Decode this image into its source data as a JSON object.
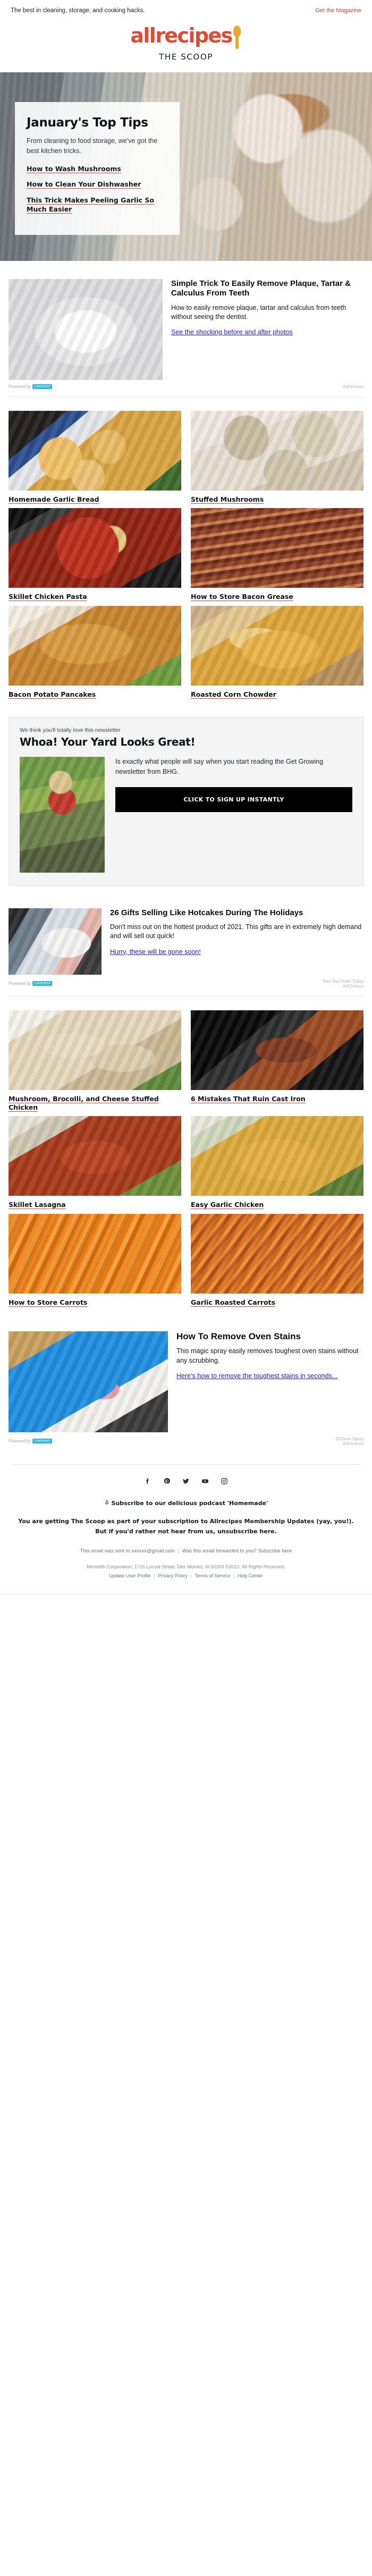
{
  "preheader": {
    "text": "The best in cleaning, storage, and cooking hacks.",
    "magazine_link": "Get the Magazine"
  },
  "brand": {
    "logo_word": "allrecipes",
    "tagline": "THE SCOOP"
  },
  "hero": {
    "title": "January's Top Tips",
    "subtitle": "From cleaning to food storage, we've got the best kitchen tricks.",
    "links": [
      "How to Wash Mushrooms",
      "How to Clean Your Dishwasher",
      "This Trick Makes Peeling Garlic So Much Easier"
    ]
  },
  "ads": [
    {
      "title": "Simple Trick To Easily Remove Plaque, Tartar & Calculus From Teeth",
      "description": "How to easily remove plaque, tartar and calculus from teeth without seeing the dentist.",
      "cta": "See the shocking before and after photos",
      "powered_label": "Powered by",
      "powered_badge": "LiveIntent",
      "sponsor": "",
      "adchoices": "AdChoices"
    },
    {
      "title": "26 Gifts Selling Like Hotcakes During The Holidays",
      "description": "Don't miss out on the hottest product of 2021. This gifts are in extremely high demand and will sell out quick!",
      "cta": "Hurry, these will be gone soon!",
      "powered_label": "Powered by",
      "powered_badge": "LiveIntent",
      "sponsor": "Your Top Deals Today",
      "adchoices": "AdChoices"
    },
    {
      "title": "How To Remove Oven Stains",
      "description": "This magic spray easily removes toughest oven stains without any scrubbing.",
      "cta": "Here's how to remove the toughest stains in seconds...",
      "powered_label": "Powered by",
      "powered_badge": "LiveIntent",
      "sponsor": "DrClean Spray",
      "adchoices": "AdChoices"
    }
  ],
  "recipes_top": [
    {
      "title": "Homemade Garlic Bread"
    },
    {
      "title": "Stuffed Mushrooms"
    },
    {
      "title": "Skillet Chicken Pasta"
    },
    {
      "title": "How to Store Bacon Grease"
    },
    {
      "title": "Bacon Potato Pancakes"
    },
    {
      "title": "Roasted Corn Chowder"
    }
  ],
  "recipes_bottom": [
    {
      "title": "Mushroom, Brocolli, and Cheese Stuffed Chicken"
    },
    {
      "title": "6 Mistakes That Ruin Cast Iron"
    },
    {
      "title": "Skillet Lasagna"
    },
    {
      "title": "Easy Garlic Chicken"
    },
    {
      "title": "How to Store Carrots"
    },
    {
      "title": "Garlic Roasted Carrots"
    }
  ],
  "promo": {
    "kicker": "We think you'll totally love this newsletter",
    "headline": "Whoa! Your Yard Looks Great!",
    "copy": "Is exactly what people will say when you start reading the Get Growing newsletter from BHG.",
    "button": "CLICK TO SIGN UP INSTANTLY"
  },
  "footer": {
    "social": [
      {
        "name": "facebook",
        "glyph": "f"
      },
      {
        "name": "pinterest",
        "glyph": "P"
      },
      {
        "name": "twitter",
        "glyph": "t"
      },
      {
        "name": "youtube",
        "glyph": "▶"
      },
      {
        "name": "instagram",
        "glyph": "▢"
      }
    ],
    "podcast": "Subscribe to our delicious podcast 'Homemade'",
    "note": "You are getting The Scoop as part of your subscription to Allrecipes Membership Updates (yay, you!). But if you'd rather not hear from us, unsubscribe here.",
    "sent_to": "This email was sent to xxxxxx@gmail.com",
    "forwarded": "Was this email forwarded to you? Subscribe here",
    "copyright": "Meredith Corporation, 1716 Locust Street, Des Moines, IA 50309 ©2022. All Rights Reserved.",
    "links": [
      "Update User Profile",
      "Privacy Policy",
      "Terms of Service",
      "Help Center"
    ]
  },
  "colors": {
    "brand_red": "#e04a32",
    "spoon_gold": "#e8a92e",
    "link_blue": "#1f20e8",
    "underline_red": "#d9472b"
  }
}
